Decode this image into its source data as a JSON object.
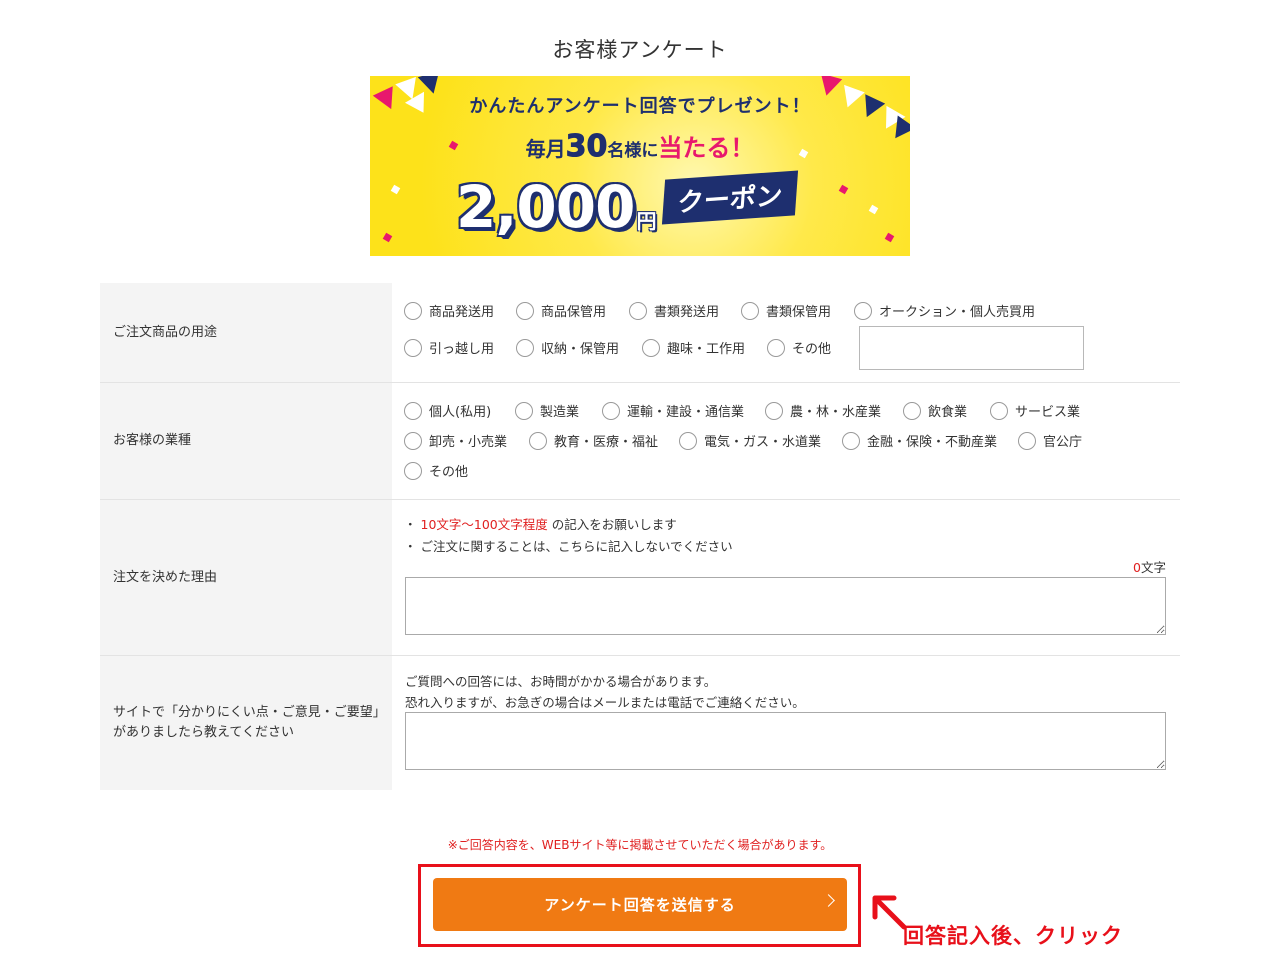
{
  "page": {
    "title": "お客様アンケート"
  },
  "banner": {
    "line1": "かんたんアンケート回答でプレゼント！",
    "line2_a": "毎月",
    "line2_num": "30",
    "line2_b": "名様に",
    "line2_c": "当たる！",
    "amount": "2,000",
    "yen": "円",
    "coupon": "クーポン",
    "colors": {
      "background": "#fde21a",
      "navy": "#1e2f6f",
      "pink": "#e8186d"
    }
  },
  "form": {
    "usage": {
      "label": "ご注文商品の用途",
      "options": [
        "商品発送用",
        "商品保管用",
        "書類発送用",
        "書類保管用",
        "オークション・個人売買用",
        "引っ越し用",
        "収納・保管用",
        "趣味・工作用",
        "その他"
      ]
    },
    "industry": {
      "label": "お客様の業種",
      "options": [
        "個人(私用)",
        "製造業",
        "運輸・建設・通信業",
        "農・林・水産業",
        "飲食業",
        "サービス業",
        "卸売・小売業",
        "教育・医療・福祉",
        "電気・ガス・水道業",
        "金融・保険・不動産業",
        "官公庁",
        "その他"
      ]
    },
    "reason": {
      "label": "注文を決めた理由",
      "note1_bullet": "・",
      "note1_red": "10文字～100文字程度",
      "note1_rest": " の記入をお願いします",
      "note2": "・ ご注文に関することは、こちらに記入しないでください",
      "counter_value": "0",
      "counter_unit": "文字"
    },
    "feedback": {
      "label_line1": "サイトで「分かりにくい点・ご意見・ご要望」",
      "label_line2": "がありましたら教えてください",
      "note1": "ご質問への回答には、お時間がかかる場合があります。",
      "note2": "恐れ入りますが、お急ぎの場合はメールまたは電話でご連絡ください。"
    }
  },
  "disclaimer": "※ご回答内容を、WEBサイト等に掲載させていただく場合があります。",
  "submit": {
    "label": "アンケート回答を送信する"
  },
  "annotation": {
    "callout": "回答記入後、クリック",
    "color": "#e8101a"
  }
}
